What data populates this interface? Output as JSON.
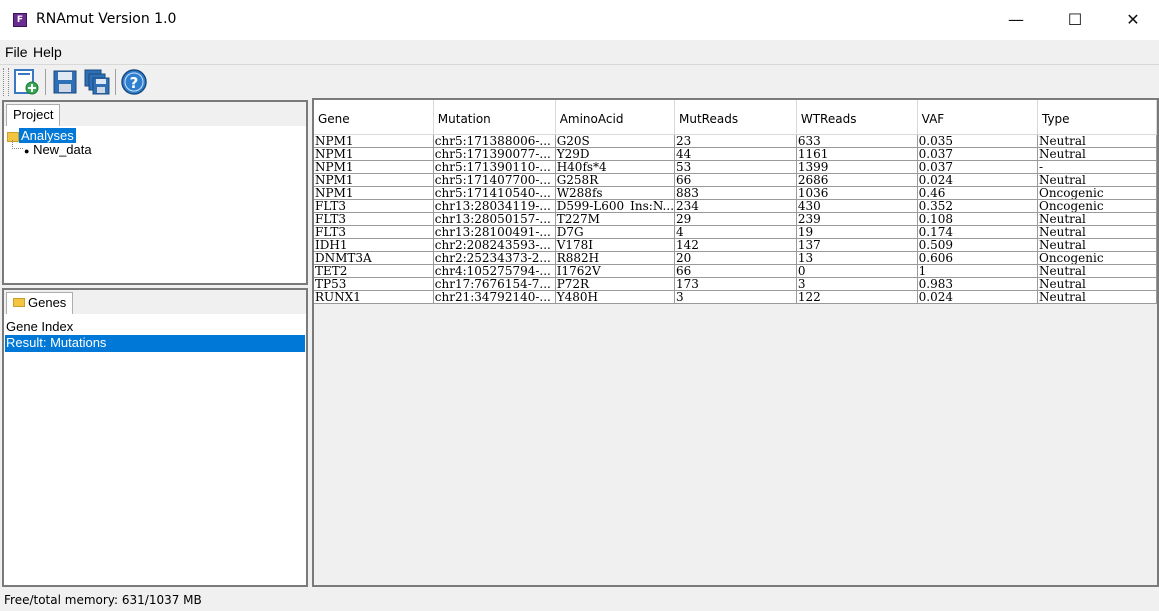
{
  "window": {
    "title": "RNAmut Version 1.0",
    "minimize": "—",
    "maximize": "☐",
    "close": "✕"
  },
  "menu": {
    "file": "File",
    "help": "Help"
  },
  "toolbar": {
    "buttons": [
      "new-document-icon",
      "save-icon",
      "save-all-icon",
      "help-icon"
    ]
  },
  "project": {
    "tab_label": "Project",
    "root": "Analyses",
    "child": "New_data"
  },
  "genes": {
    "tab_label": "Genes",
    "items": [
      "Gene Index",
      "Result: Mutations"
    ],
    "selected_index": 1
  },
  "table": {
    "columns": [
      "Gene",
      "Mutation",
      "AminoAcid",
      "MutReads",
      "WTReads",
      "VAF",
      "Type"
    ],
    "rows": [
      [
        "NPM1",
        "chr5:171388006-...",
        "G20S",
        "23",
        "633",
        "0.035",
        "Neutral"
      ],
      [
        "NPM1",
        "chr5:171390077-...",
        "Y29D",
        "44",
        "1161",
        "0.037",
        "Neutral"
      ],
      [
        "NPM1",
        "chr5:171390110-...",
        "H40fs*4",
        "53",
        "1399",
        "0.037",
        "-"
      ],
      [
        "NPM1",
        "chr5:171407700-...",
        "G258R",
        "66",
        "2686",
        "0.024",
        "Neutral"
      ],
      [
        "NPM1",
        "chr5:171410540-...",
        "W288fs",
        "883",
        "1036",
        "0.46",
        "Oncogenic"
      ],
      [
        "FLT3",
        "chr13:28034119-...",
        "D599-L600_Ins:N...",
        "234",
        "430",
        "0.352",
        "Oncogenic"
      ],
      [
        "FLT3",
        "chr13:28050157-...",
        "T227M",
        "29",
        "239",
        "0.108",
        "Neutral"
      ],
      [
        "FLT3",
        "chr13:28100491-...",
        "D7G",
        "4",
        "19",
        "0.174",
        "Neutral"
      ],
      [
        "IDH1",
        "chr2:208243593-...",
        "V178I",
        "142",
        "137",
        "0.509",
        "Neutral"
      ],
      [
        "DNMT3A",
        "chr2:25234373-2...",
        "R882H",
        "20",
        "13",
        "0.606",
        "Oncogenic"
      ],
      [
        "TET2",
        "chr4:105275794-...",
        "I1762V",
        "66",
        "0",
        "1",
        "Neutral"
      ],
      [
        "TP53",
        "chr17:7676154-7...",
        "P72R",
        "173",
        "3",
        "0.983",
        "Neutral"
      ],
      [
        "RUNX1",
        "chr21:34792140-...",
        "Y480H",
        "3",
        "122",
        "0.024",
        "Neutral"
      ]
    ]
  },
  "status": {
    "memory": "Free/total memory: 631/1037 MB"
  },
  "colors": {
    "selection": "#0078d7",
    "folder": "#f5c542"
  }
}
